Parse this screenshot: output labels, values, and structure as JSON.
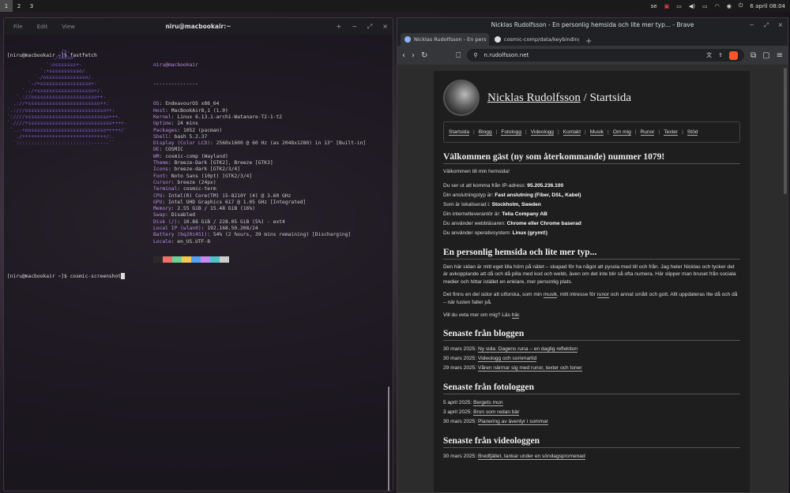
{
  "topbar": {
    "workspaces": [
      "1",
      "2",
      "3"
    ],
    "lang": "se",
    "clock": "6 april 08:04"
  },
  "terminal": {
    "menu": [
      "File",
      "Edit",
      "View"
    ],
    "title": "niru@macbookair:~",
    "cmd1": "[niru@macbookair ~]$ fastfetch",
    "logo": [
      "                 ./o.",
      "               ./sssso-",
      "             `:osssssss+-",
      "           `:+sssssssssso/.",
      "         `-/ossssssssssssso/.",
      "       `-/+sssssssssssssssso+:`",
      "     `-:/+sssssssssssssssssso+/.",
      "   `.://osssssssssssssssssssso++-",
      "  .://+ssssssssssssssssssssssso++:",
      "`.:///ossssssssssssssssssssssssso++:",
      "`:////ssssssssssssssssssssssssssso+++.",
      "`-////+ssssssssssssssssssssssssssso++++-",
      " `..-+oosssssssssssssssssssssssso+++++/`",
      "   ./++++++++++++++++++++++++++++/:.",
      "  `:::::::::::::::::::::::::------``"
    ],
    "user_host": "niru@macbookair",
    "divider": "---------------",
    "info": [
      {
        "k": "OS",
        "v": "EndeavourOS x86_64"
      },
      {
        "k": "Host",
        "v": "MacBookAir8,1 (1.0)"
      },
      {
        "k": "Kernel",
        "v": "Linux 6.13.1-arch1-Watanare-T2-1-t2"
      },
      {
        "k": "Uptime",
        "v": "24 mins"
      },
      {
        "k": "Packages",
        "v": "1052 (pacman)"
      },
      {
        "k": "Shell",
        "v": "bash 5.2.37"
      },
      {
        "k": "Display (Color LCD)",
        "v": "2560x1600 @ 60 Hz (as 2048x1280) in 13\" [Built-in]"
      },
      {
        "k": "DE",
        "v": "COSMIC"
      },
      {
        "k": "WM",
        "v": "cosmic-comp (Wayland)"
      },
      {
        "k": "Theme",
        "v": "Breeze-Dark [GTK2], Breeze [GTK3]"
      },
      {
        "k": "Icons",
        "v": "breeze-dark [GTK2/3/4]"
      },
      {
        "k": "Font",
        "v": "Noto Sans (10pt) [GTK2/3/4]"
      },
      {
        "k": "Cursor",
        "v": "breeze (24px)"
      },
      {
        "k": "Terminal",
        "v": "cosmic-term"
      },
      {
        "k": "CPU",
        "v": "Intel(R) Core(TM) i5-8210Y (4) @ 3.60 GHz"
      },
      {
        "k": "GPU",
        "v": "Intel UHD Graphics 617 @ 1.05 GHz [Integrated]"
      },
      {
        "k": "Memory",
        "v": "2.55 GiB / 15.48 GiB (16%)"
      },
      {
        "k": "Swap",
        "v": "Disabled"
      },
      {
        "k": "Disk (/)",
        "v": "10.86 GiB / 228.05 GiB (5%) - ext4"
      },
      {
        "k": "Local IP (wlan0)",
        "v": "192.168.50.208/24"
      },
      {
        "k": "Battery (bq20z451)",
        "v": "54% (2 hours, 39 mins remaining) [Discharging]"
      },
      {
        "k": "Locale",
        "v": "en_US.UTF-8"
      }
    ],
    "swatch_colors": [
      "#2a2a2a",
      "#ef6f6c",
      "#6fcf97",
      "#f2c94c",
      "#56a0f0",
      "#c58af0",
      "#4fc3c8",
      "#cccccc"
    ],
    "cmd2": "[niru@macbookair ~]$ cosmic-screenshot"
  },
  "browser": {
    "title": "Nicklas Rudolfsson - En personlig hemsida och lite mer typ... - Brave",
    "tabs": [
      {
        "label": "Nicklas Rudolfsson - En pers"
      },
      {
        "label": "cosmic-comp/data/keybindings"
      }
    ],
    "url": "n.rudolfsson.net",
    "site": {
      "name": "Nicklas Rudolfsson",
      "section": " / Startsida",
      "nav": [
        "Startsida",
        "Blogg",
        "Fotologg",
        "Videologg",
        "Kontakt",
        "Musik",
        "Om mig",
        "Runor",
        "Texter",
        "Stöd"
      ],
      "welcome_h": "Välkommen gäst (ny som återkommande) nummer 1079!",
      "welcome_p": "Välkommen till min hemsida!",
      "info": [
        {
          "pre": "Du ser ut att komma från IP-adress: ",
          "b": "95.205.236.100"
        },
        {
          "pre": "Din anslutningstyp är: ",
          "b": "Fast anslutning (Fiber, DSL, Kabel)"
        },
        {
          "pre": "Som är lokaliserad i: ",
          "b": "Stockholm, Sweden"
        },
        {
          "pre": "Din internetleverantör är: ",
          "b": "Telia Company AB"
        },
        {
          "pre": "Du använder webbläsaren: ",
          "b": "Chrome eller Chrome baserad"
        },
        {
          "pre": "Du använder operativsystem: ",
          "b": "Linux (grymt!)"
        }
      ],
      "about_h": "En personlig hemsida och lite mer typ...",
      "about_p1": "Den här sidan är mitt eget lilla hörn på nätet – skapad för ha något att pyssla med till och från. Jag heter Nicklas och tycker det är avkopplande att då och då pilla med kod och webb, även om det inte blir så ofta numera. Här slipper man bruset från sociala medier och hittar istället en enklare, mer personlig plats.",
      "about_p2_a": "Det finns en del sidor att utforska, som min ",
      "about_p2_l1": "musik",
      "about_p2_b": ", mitt intresse för ",
      "about_p2_l2": "runor",
      "about_p2_c": " och annat smått och gott. Allt uppdateras lite då och då – när lusten faller på.",
      "about_p3_a": "Vill du veta mer om mig? Läs ",
      "about_p3_l": "här",
      "about_p3_b": ".",
      "blog_h": "Senaste från bloggen",
      "blog": [
        {
          "d": "30 mars 2025: ",
          "t": "Ny sida: Dagens runa – en daglig reflektion"
        },
        {
          "d": "30 mars 2025: ",
          "t": "Videologg och sommartid"
        },
        {
          "d": "29 mars 2025: ",
          "t": "Våren närmar sig med runor, texter och toner"
        }
      ],
      "foto_h": "Senaste från fotologgen",
      "foto": [
        {
          "d": "5 april 2025: ",
          "t": "Bergets mun"
        },
        {
          "d": "3 april 2025: ",
          "t": "Bron som redan bär"
        },
        {
          "d": "30 mars 2025: ",
          "t": "Planering av äventyr i sommar"
        }
      ],
      "video_h": "Senaste från videologgen",
      "video": [
        {
          "d": "30 mars 2025: ",
          "t": "Bredfjället, tankar under en söndagspromenad"
        }
      ]
    }
  }
}
